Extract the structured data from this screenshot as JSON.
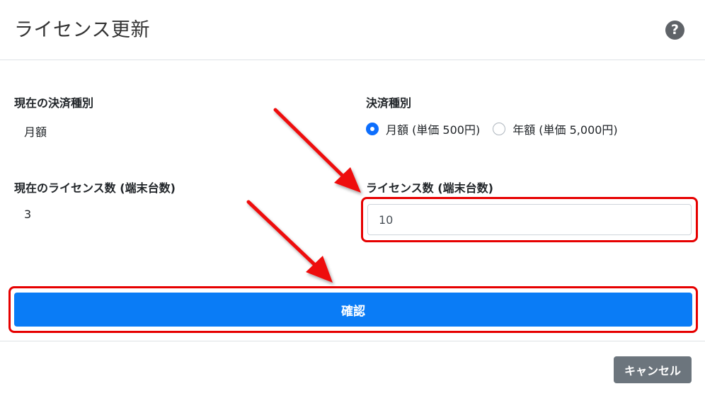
{
  "dialog": {
    "title": "ライセンス更新",
    "help_icon": "question-circle-icon"
  },
  "current_payment": {
    "label": "現在の決済種別",
    "value": "月額"
  },
  "payment_type": {
    "label": "決済種別",
    "options": [
      {
        "label": "月額 (単価 500円)",
        "selected": true
      },
      {
        "label": "年額 (単価 5,000円)",
        "selected": false
      }
    ]
  },
  "current_licenses": {
    "label": "現在のライセンス数 (端末台数)",
    "value": "3"
  },
  "license_count": {
    "label": "ライセンス数 (端末台数)",
    "value": "10"
  },
  "buttons": {
    "confirm": "確認",
    "cancel": "キャンセル"
  },
  "colors": {
    "primary": "#0a7cf6",
    "secondary": "#6c757d",
    "annotation": "#e60000"
  }
}
